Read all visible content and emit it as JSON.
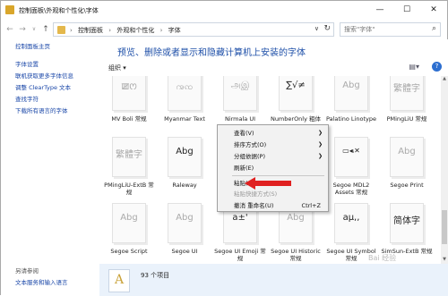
{
  "window": {
    "title": "控制面板\\外观和个性化\\字体",
    "minimize": "—",
    "maximize": "☐",
    "close": "✕"
  },
  "address": {
    "crumbs": [
      "控制面板",
      "外观和个性化",
      "字体"
    ],
    "search_placeholder": "搜索\"字体\""
  },
  "sidebar": {
    "home": "控制面板主页",
    "links": [
      "字体设置",
      "联机获取更多字体信息",
      "调整 ClearType 文本",
      "查找字符",
      "下载所有语言的字体"
    ],
    "see_also_title": "另请参阅",
    "see_also": [
      "文本服务和输入语言"
    ]
  },
  "main": {
    "heading": "预览、删除或者显示和隐藏计算机上安装的字体",
    "organize": "组织 ▾",
    "status_count": "93 个项目"
  },
  "fonts": [
    {
      "name": "MV Boli 常规",
      "sample": "ꯀꯁ"
    },
    {
      "name": "Myanmar Text",
      "sample": "ꩠꩡ"
    },
    {
      "name": "Nirmala UI",
      "sample": "அஇ"
    },
    {
      "name": "NumberOnly 粗体",
      "sample": "∑√≠"
    },
    {
      "name": "Palatino Linotype",
      "sample": "Abg"
    },
    {
      "name": "PMingLiU 常规",
      "sample": "繁體字"
    },
    {
      "name": "PMingLiU-ExtB 常规",
      "sample": "繁體字"
    },
    {
      "name": "Raleway",
      "sample": "Abg"
    },
    {
      "name": "",
      "sample": ""
    },
    {
      "name": "",
      "sample": ""
    },
    {
      "name": "Segoe MDL2 Assets 常规",
      "sample": "▭◂ᵢ✕"
    },
    {
      "name": "Segoe Print",
      "sample": "Abg"
    },
    {
      "name": "Segoe Script",
      "sample": "Abg"
    },
    {
      "name": "Segoe UI",
      "sample": "Abg"
    },
    {
      "name": "Segoe UI Emoji 常规",
      "sample": "a±'"
    },
    {
      "name": "Segoe UI Historic 常规",
      "sample": "Abg"
    },
    {
      "name": "Segoe UI Symbol 常规",
      "sample": "aμ,,"
    },
    {
      "name": "SimSun-ExtB 常规",
      "sample": "简体字"
    }
  ],
  "context_menu": {
    "view": "查看(V)",
    "sort": "排序方式(O)",
    "group": "分组依据(P)",
    "refresh": "刷新(E)",
    "paste": "粘贴(P)",
    "paste_shortcut": "粘贴快捷方式(S)",
    "undo": "撤消 重命名(U)",
    "undo_key": "Ctrl+Z"
  },
  "watermark": "Bai 经验"
}
